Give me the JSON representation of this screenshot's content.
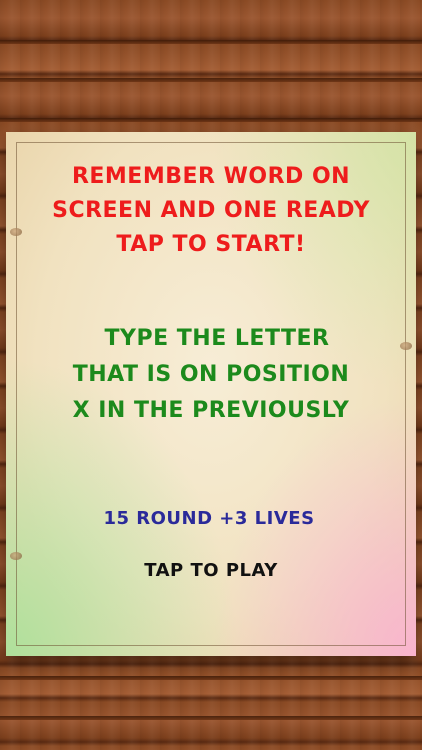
{
  "instructions": {
    "line1": "REMEMBER WORD ON",
    "line2": "SCREEN AND ONE READY",
    "line3": "TAP TO START!"
  },
  "rules": {
    "line1": "TYPE THE LETTER",
    "line2": "THAT IS ON POSITION",
    "line3": "X IN THE PREVIOUSLY"
  },
  "stats": {
    "rounds_lives": "15 ROUND +3 LIVES"
  },
  "play": {
    "label": "TAP TO PLAY"
  },
  "colors": {
    "instructions": "#ee1c1c",
    "rules": "#1c8a1c",
    "stats": "#2a2a9a",
    "play": "#111111"
  }
}
